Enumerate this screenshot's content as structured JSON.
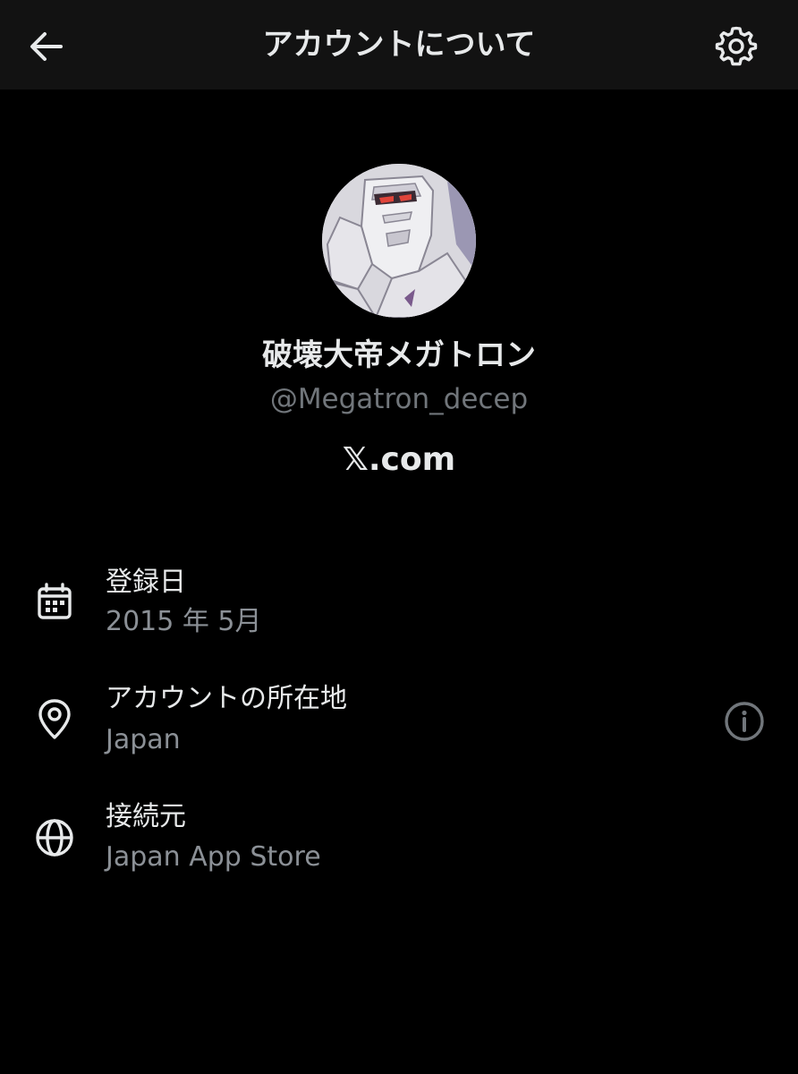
{
  "header": {
    "title": "アカウントについて",
    "back_icon": "arrow-left-icon",
    "settings_icon": "gear-icon"
  },
  "profile": {
    "display_name": "破壊大帝メガトロン",
    "handle": "@Megatron_decep",
    "source": "𝕏.com"
  },
  "details": [
    {
      "icon": "calendar-icon",
      "label": "登録日",
      "value": "2015 年 5月"
    },
    {
      "icon": "location-pin-icon",
      "label": "アカウントの所在地",
      "value": "Japan",
      "info_icon": "info-icon"
    },
    {
      "icon": "globe-icon",
      "label": "接続元",
      "value": "Japan App Store"
    }
  ],
  "colors": {
    "background": "#000000",
    "header_background": "#121212",
    "primary_text": "#e7e9ea",
    "secondary_text": "#71767b"
  }
}
